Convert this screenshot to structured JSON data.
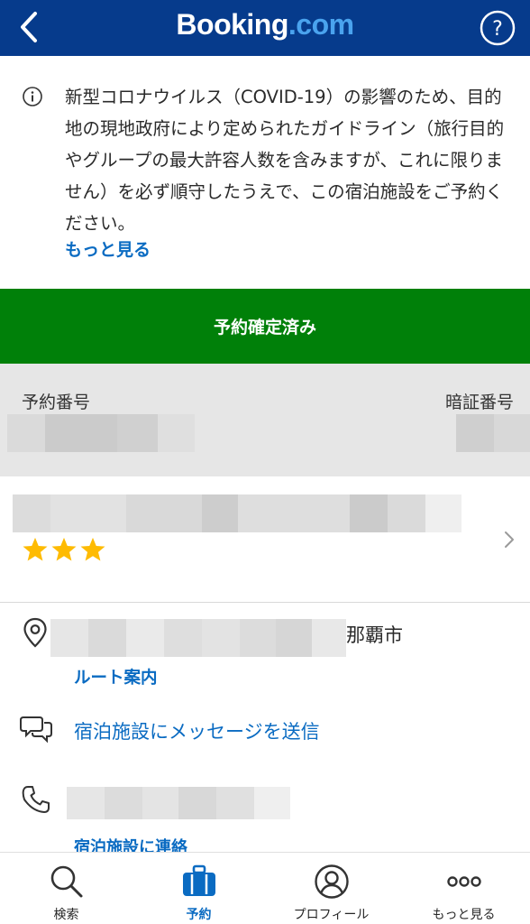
{
  "header": {
    "logo_main": "Booking",
    "logo_suffix": ".com",
    "back_icon": "chevron-left-icon",
    "help_icon": "question-circle-icon"
  },
  "notice": {
    "icon": "info-icon",
    "text": "新型コロナウイルス（COVID-19）の影響のため、目的地の現地政府により定められたガイドライン（旅行目的やグループの最大許容人数を含みますが、これに限りません）を必ず順守したうえで、この宿泊施設をご予約ください。",
    "more_label": "もっと見る"
  },
  "status": {
    "label": "予約確定済み",
    "color": "#008009"
  },
  "booking_numbers": {
    "booking_number_label": "予約番号",
    "pin_label": "暗証番号"
  },
  "hotel": {
    "star_rating": 3,
    "star_color": "#febb02"
  },
  "address": {
    "icon": "map-pin-icon",
    "city": "那覇市",
    "route_label": "ルート案内"
  },
  "message": {
    "icon": "chat-bubbles-icon",
    "label": "宿泊施設にメッセージを送信"
  },
  "phone": {
    "icon": "phone-icon",
    "contact_label": "宿泊施設に連絡"
  },
  "bottom_nav": {
    "items": [
      {
        "label": "検索",
        "icon": "search-icon",
        "active": false
      },
      {
        "label": "予約",
        "icon": "suitcase-icon",
        "active": true
      },
      {
        "label": "プロフィール",
        "icon": "profile-icon",
        "active": false
      },
      {
        "label": "もっと見る",
        "icon": "more-dots-icon",
        "active": false
      }
    ]
  },
  "colors": {
    "header_bg": "#063b8c",
    "link": "#0a6bc2",
    "accent": "#4aa3ee"
  }
}
